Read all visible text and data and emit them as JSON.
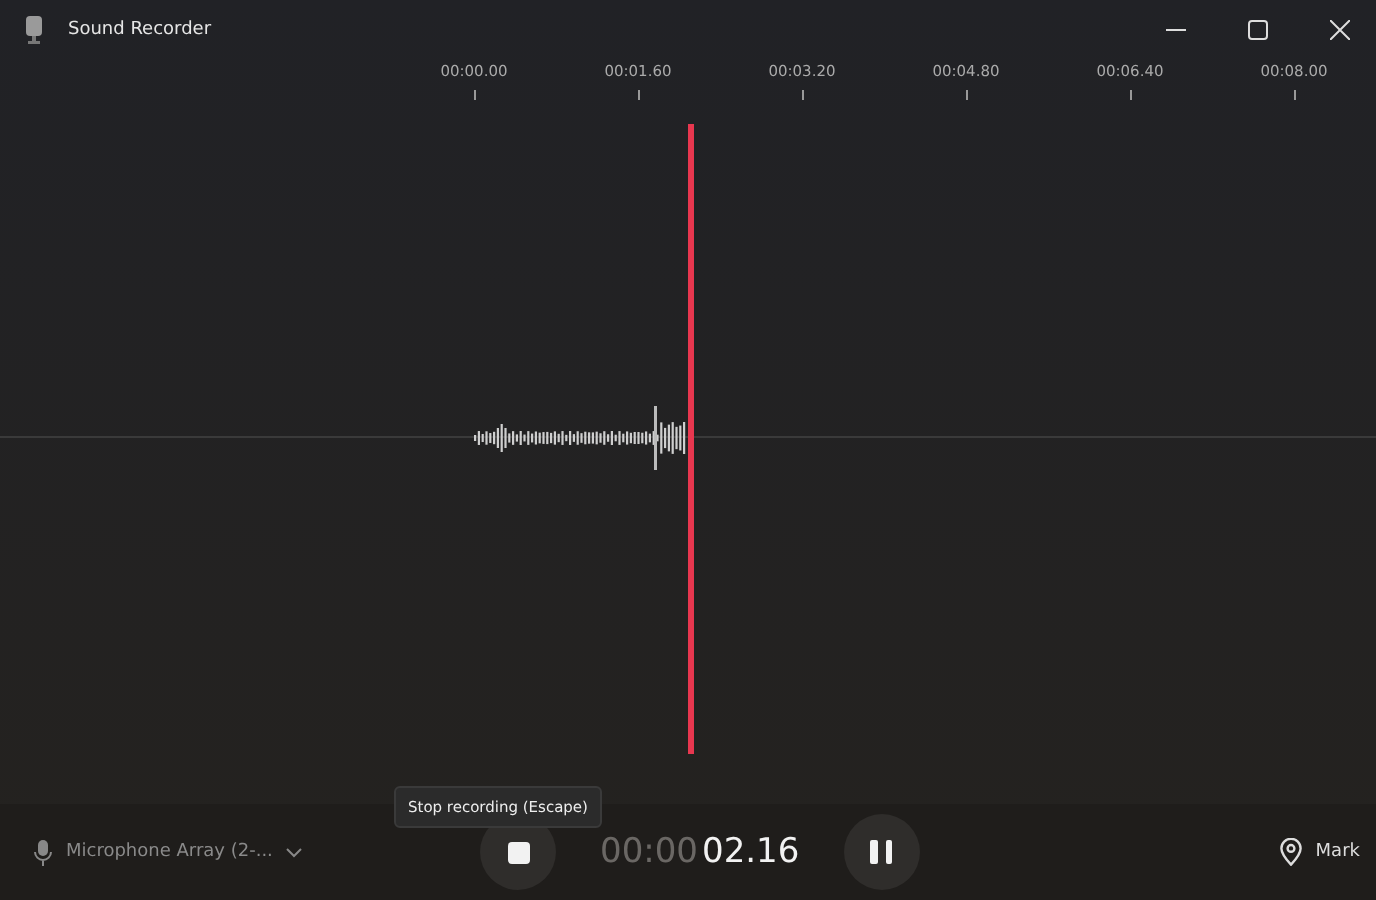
{
  "window": {
    "title": "Sound Recorder"
  },
  "timeline": {
    "ticks": [
      "00:00.00",
      "00:01.60",
      "00:03.20",
      "00:04.80",
      "00:06.40",
      "00:08.00"
    ]
  },
  "device": {
    "label": "Microphone Array (2-..."
  },
  "tooltip": "Stop recording (Escape)",
  "timer": {
    "leading": "00:00",
    "elapsed": "02.16"
  },
  "mark_button": "Mark"
}
